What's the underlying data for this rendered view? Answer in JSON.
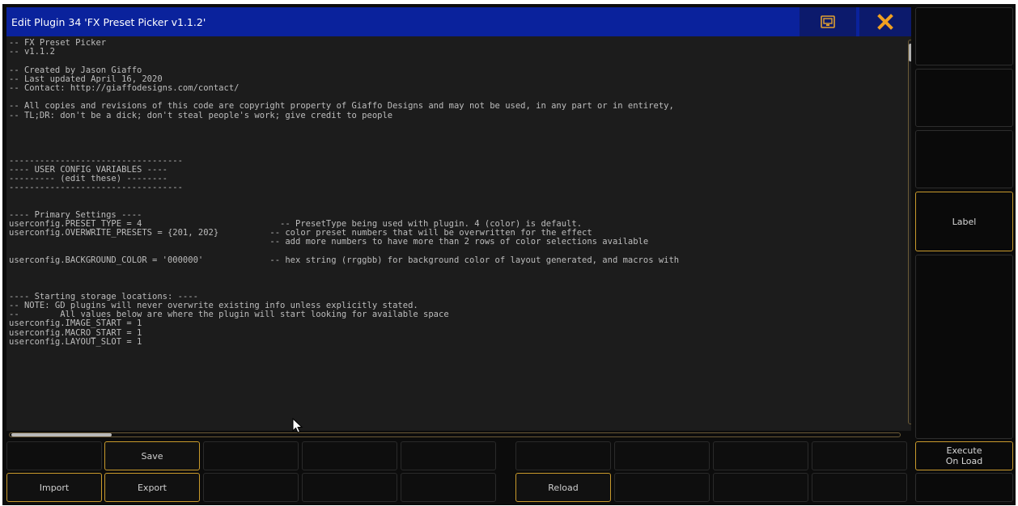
{
  "window": {
    "title": "Edit Plugin 34 'FX Preset Picker v1.1.2'",
    "keyboard_icon": "keyboard-icon",
    "close_icon": "close-x-icon",
    "accent_color": "#c99a2c",
    "title_bar_color": "#0a229c"
  },
  "editor": {
    "lines": [
      "-- FX Preset Picker",
      "-- v1.1.2",
      "",
      "-- Created by Jason Giaffo",
      "-- Last updated April 16, 2020",
      "-- Contact: http://giaffodesigns.com/contact/",
      "",
      "-- All copies and revisions of this code are copyright property of Giaffo Designs and may not be used, in any part or in entirety,",
      "-- TL;DR: don't be a dick; don't steal people's work; give credit to people",
      "",
      "",
      "",
      "",
      "----------------------------------",
      "---- USER CONFIG VARIABLES ----",
      "--------- (edit these) --------",
      "----------------------------------",
      "",
      "",
      "---- Primary Settings ----",
      "userconfig.PRESET_TYPE = 4                           -- PresetType being used with plugin. 4 (color) is default.",
      "userconfig.OVERWRITE_PRESETS = {201, 202}          -- color preset numbers that will be overwritten for the effect",
      "                                                   -- add more numbers to have more than 2 rows of color selections available",
      "",
      "userconfig.BACKGROUND_COLOR = '000000'             -- hex string (rrggbb) for background color of layout generated, and macros with",
      "",
      "",
      "",
      "---- Starting storage locations: ----",
      "-- NOTE: GD plugins will never overwrite existing info unless explicitly stated.",
      "--        All values below are where the plugin will start looking for available space",
      "userconfig.IMAGE_START = 1",
      "userconfig.MACRO_START = 1",
      "userconfig.LAYOUT_SLOT = 1"
    ]
  },
  "side_panel": {
    "label_button": "Label",
    "execute_on_load": "Execute On Load"
  },
  "toolbar": {
    "save": "Save",
    "import": "Import",
    "export": "Export",
    "reload": "Reload"
  }
}
